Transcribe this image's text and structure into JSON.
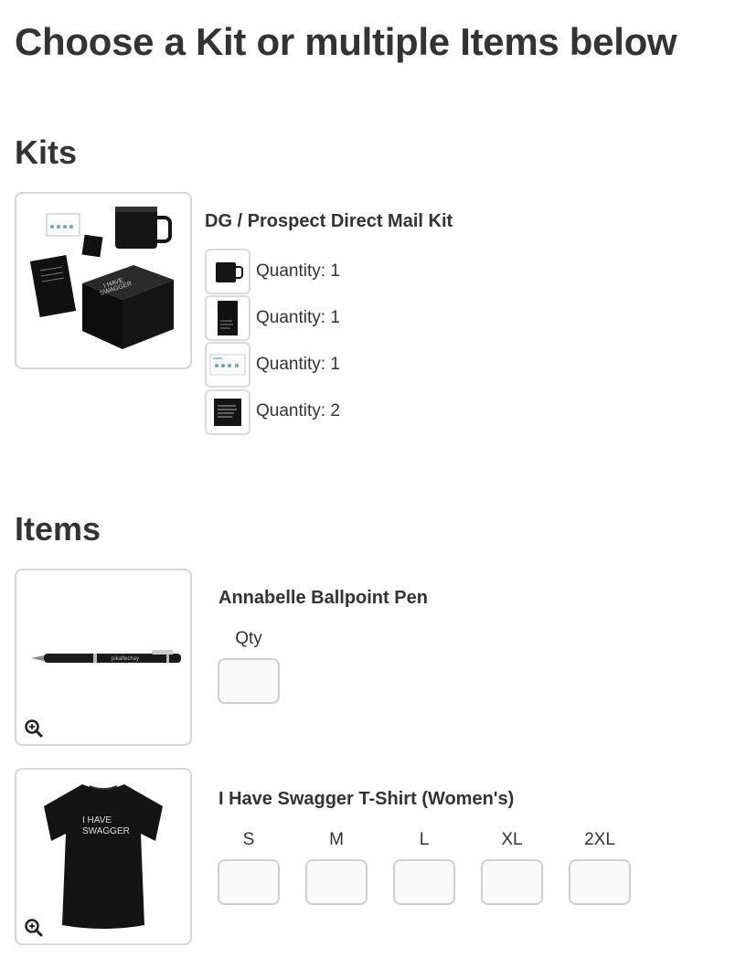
{
  "page": {
    "title": "Choose a Kit or multiple Items below"
  },
  "kits": {
    "heading": "Kits",
    "kit": {
      "name": "DG / Prospect Direct Mail Kit",
      "image_icon": "kit-box-image",
      "components": [
        {
          "label": "Quantity: 1",
          "icon": "mug-image"
        },
        {
          "label": "Quantity: 1",
          "icon": "card-black-image"
        },
        {
          "label": "Quantity: 1",
          "icon": "postcard-image"
        },
        {
          "label": "Quantity: 2",
          "icon": "sticker-image"
        }
      ]
    }
  },
  "items": {
    "heading": "Items",
    "pen": {
      "name": "Annabelle Ballpoint Pen",
      "qty_label": "Qty",
      "qty_value": "",
      "image_icon": "pen-image"
    },
    "tshirt": {
      "name": "I Have Swagger T-Shirt (Women's)",
      "image_icon": "tshirt-image",
      "shirt_text": "I HAVE SWAGGER",
      "sizes": [
        {
          "label": "S",
          "value": ""
        },
        {
          "label": "M",
          "value": ""
        },
        {
          "label": "L",
          "value": ""
        },
        {
          "label": "XL",
          "value": ""
        },
        {
          "label": "2XL",
          "value": ""
        }
      ]
    }
  },
  "colors": {
    "text": "#333333",
    "border": "#d6d6d6",
    "product": "#111111"
  }
}
